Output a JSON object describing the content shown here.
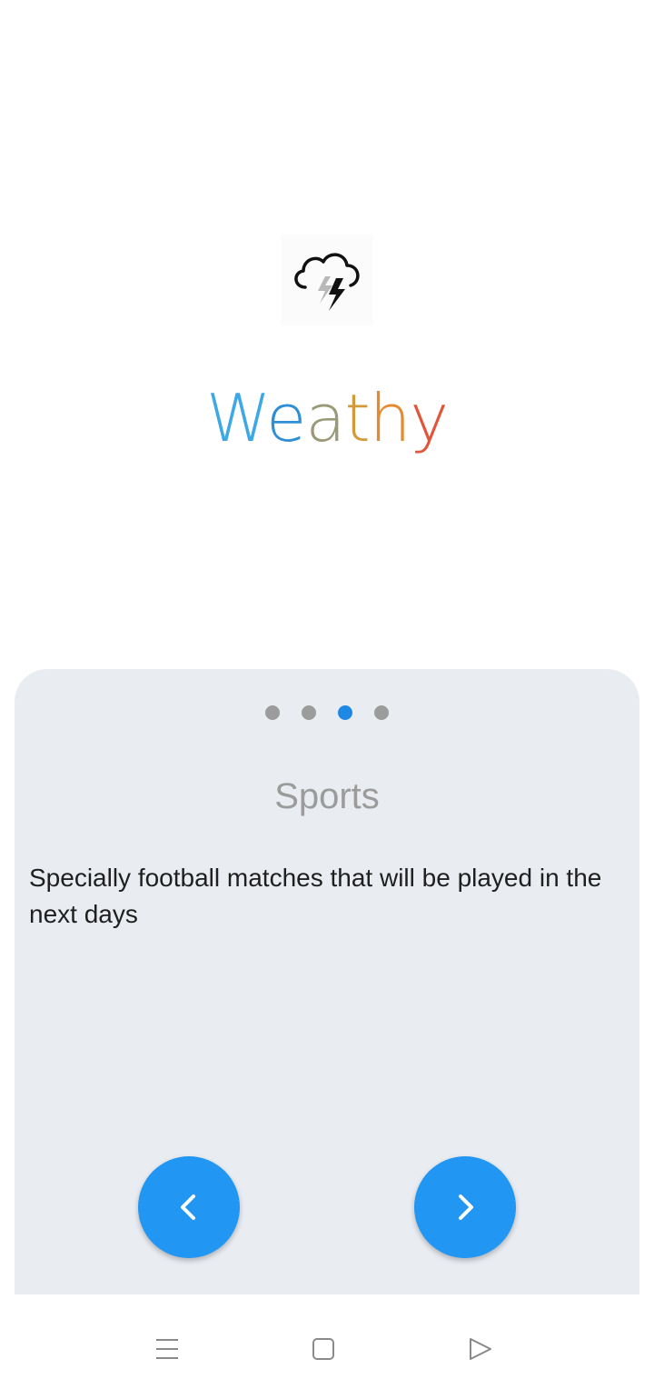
{
  "app": {
    "name_letters": [
      {
        "ch": "W",
        "color": "#3ea7e6"
      },
      {
        "ch": "e",
        "color": "#2e8fd4"
      },
      {
        "ch": "a",
        "color": "#9a9a78"
      },
      {
        "ch": "t",
        "color": "#d39a3a"
      },
      {
        "ch": "h",
        "color": "#e58a2f"
      },
      {
        "ch": "y",
        "color": "#e2553a"
      }
    ],
    "logo_icon": "thunderstorm-cloud-icon"
  },
  "onboarding": {
    "pages_total": 4,
    "active_page_index": 2,
    "title": "Sports",
    "description": "Specially football matches that will be played in the next days",
    "prev_icon": "chevron-left-icon",
    "next_icon": "chevron-right-icon"
  },
  "colors": {
    "accent": "#2196f3",
    "active_dot": "#1e88e5",
    "inactive_dot": "#9c9c9c",
    "card_background": "#e9edf2"
  },
  "system_nav": {
    "icons": [
      "menu-icon",
      "home-icon",
      "back-icon"
    ]
  }
}
